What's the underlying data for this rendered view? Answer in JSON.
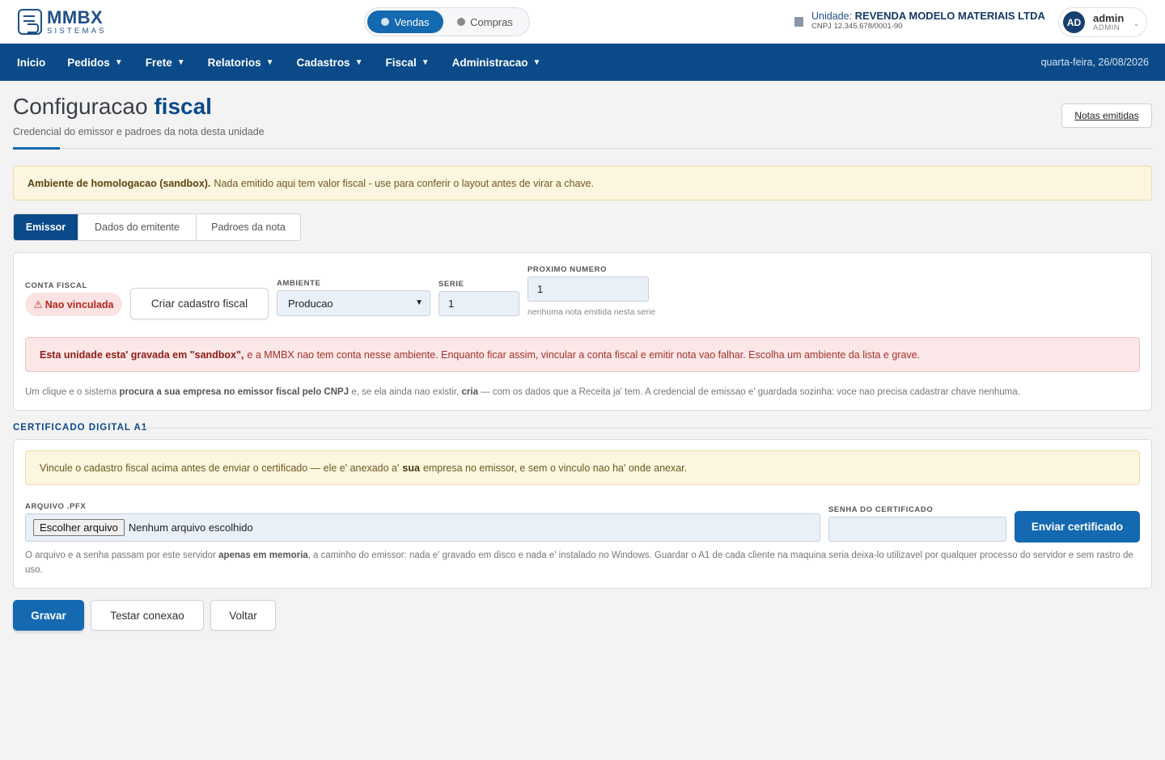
{
  "brand": {
    "name": "MMBX",
    "sub": "SISTEMAS"
  },
  "mode_switch": {
    "active": "Vendas",
    "inactive": "Compras"
  },
  "unit": {
    "label": "Unidade:",
    "name": "REVENDA MODELO MATERIAIS LTDA",
    "cnpj": "CNPJ 12.345.678/0001-90"
  },
  "user": {
    "initials": "AD",
    "name": "admin",
    "role": "ADMIN"
  },
  "nav": {
    "items": [
      {
        "label": "Inicio",
        "has_menu": false
      },
      {
        "label": "Pedidos",
        "has_menu": true
      },
      {
        "label": "Frete",
        "has_menu": true
      },
      {
        "label": "Relatorios",
        "has_menu": true
      },
      {
        "label": "Cadastros",
        "has_menu": true
      },
      {
        "label": "Fiscal",
        "has_menu": true
      },
      {
        "label": "Administracao",
        "has_menu": true
      }
    ],
    "caret": "▼",
    "date": "quarta-feira, 26/08/2026"
  },
  "page": {
    "title_light": "Configuracao",
    "title_bold": "fiscal",
    "subtitle": "Credencial do emissor e padroes da nota desta unidade",
    "notes_button": "Notas emitidas"
  },
  "sandbox_warning": {
    "bold": "Ambiente de homologacao (sandbox).",
    "text": "Nada emitido aqui tem valor fiscal - use para conferir o layout antes de virar a chave."
  },
  "tabs": [
    {
      "label": "Emissor",
      "active": true
    },
    {
      "label": "Dados do emitente",
      "active": false
    },
    {
      "label": "Padroes da nota",
      "active": false
    }
  ],
  "emissor": {
    "conta_label": "CONTA FISCAL",
    "status_icon": "⚠",
    "status": "Nao vinculada",
    "create_button": "Criar cadastro fiscal",
    "ambiente_label": "AMBIENTE",
    "ambiente_value": "Producao",
    "serie_label": "SERIE",
    "serie_value": "1",
    "proximo_label": "PROXIMO NUMERO",
    "proximo_value": "1",
    "proximo_hint": "nenhuma nota emitida nesta serie",
    "alert_bold": "Esta unidade esta' gravada em \"sandbox\",",
    "alert_text": "e a MMBX nao tem conta nesse ambiente. Enquanto ficar assim, vincular a conta fiscal e emitir nota vao falhar. Escolha um ambiente da lista e grave.",
    "note": {
      "t1": "Um clique e o sistema",
      "b1": "procura a sua empresa no emissor fiscal pelo CNPJ",
      "t2": "e, se ela ainda nao existir,",
      "b2": "cria",
      "t3": "— com os dados que a Receita ja' tem. A credencial de emissao e' guardada sozinha: voce nao precisa cadastrar chave nenhuma."
    }
  },
  "certificado": {
    "section_title": "CERTIFICADO DIGITAL A1",
    "alert": {
      "t1": "Vincule o cadastro fiscal acima antes de enviar o certificado — ele e' anexado a'",
      "b1": "sua",
      "t2": "empresa no emissor, e sem o vinculo nao ha' onde anexar."
    },
    "file_label": "ARQUIVO .PFX",
    "file_button": "Escolher arquivo",
    "file_status": "Nenhum arquivo escolhido",
    "password_label": "SENHA DO CERTIFICADO",
    "password_value": "",
    "send_button": "Enviar certificado",
    "note": {
      "t1": "O arquivo e a senha passam por este servidor",
      "b1": "apenas em memoria",
      "t2": ", a caminho do emissor: nada e' gravado em disco e nada e' instalado no Windows. Guardar o A1 de cada cliente na maquina seria deixa-lo utilizavel por qualquer processo do servidor e sem rastro de uso."
    }
  },
  "actions": {
    "save": "Gravar",
    "test": "Testar conexao",
    "back": "Voltar"
  }
}
